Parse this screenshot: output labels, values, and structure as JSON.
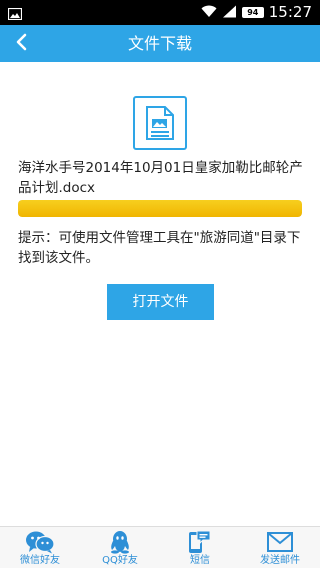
{
  "status_bar": {
    "time": "15:27",
    "battery": "94",
    "icons": [
      "image-notification-icon",
      "wifi-icon",
      "signal-icon",
      "battery-icon"
    ]
  },
  "header": {
    "title": "文件下载",
    "back_icon": "chevron-left-icon"
  },
  "main": {
    "file_icon": "document-icon",
    "file_name": "海洋水手号2014年10月01日皇家加勒比邮轮产品计划.docx",
    "progress": 1.0,
    "hint": "提示：可使用文件管理工具在\"旅游同道\"目录下找到该文件。",
    "open_button": "打开文件"
  },
  "share_bar": {
    "items": [
      {
        "label": "微信好友",
        "icon": "wechat-icon"
      },
      {
        "label": "QQ好友",
        "icon": "qq-icon"
      },
      {
        "label": "短信",
        "icon": "sms-icon"
      },
      {
        "label": "发送邮件",
        "icon": "mail-icon"
      }
    ]
  },
  "colors": {
    "accent": "#2ea5e6",
    "progress": "#f5c518",
    "share_label": "#2e8fd6"
  }
}
